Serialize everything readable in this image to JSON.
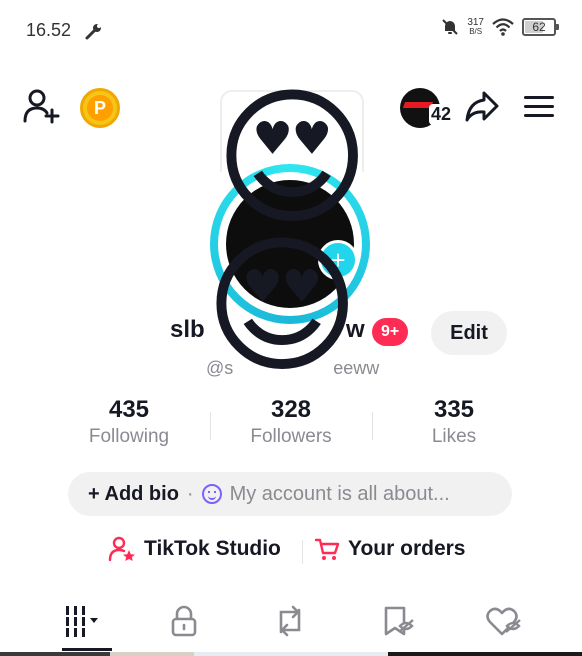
{
  "status_bar": {
    "time": "16.52",
    "net_speed_value": "317",
    "net_speed_unit": "B/S",
    "battery": "62"
  },
  "header": {
    "story_count": "42"
  },
  "profile": {
    "name_start": "slb",
    "name_end": "w",
    "notification_badge": "9+",
    "edit_label": "Edit",
    "handle_start": "@s",
    "handle_end": "eeww"
  },
  "stats": [
    {
      "value": "435",
      "label": "Following"
    },
    {
      "value": "328",
      "label": "Followers"
    },
    {
      "value": "335",
      "label": "Likes"
    }
  ],
  "bio": {
    "add_label": "+ Add bio",
    "dot": "·",
    "placeholder": "My account is all about..."
  },
  "links": {
    "studio": "TikTok Studio",
    "orders": "Your orders"
  },
  "overlay": {
    "emoji": "😍"
  },
  "colors": {
    "accent_pink": "#fe2c55",
    "ring_cyan": "#20d5ec",
    "coin_gold": "#f5c518"
  },
  "icons": [
    "add-friend-icon",
    "coin-icon",
    "share-icon",
    "menu-icon",
    "grid-icon",
    "lock-icon",
    "repost-icon",
    "saved-icon",
    "liked-icon"
  ]
}
